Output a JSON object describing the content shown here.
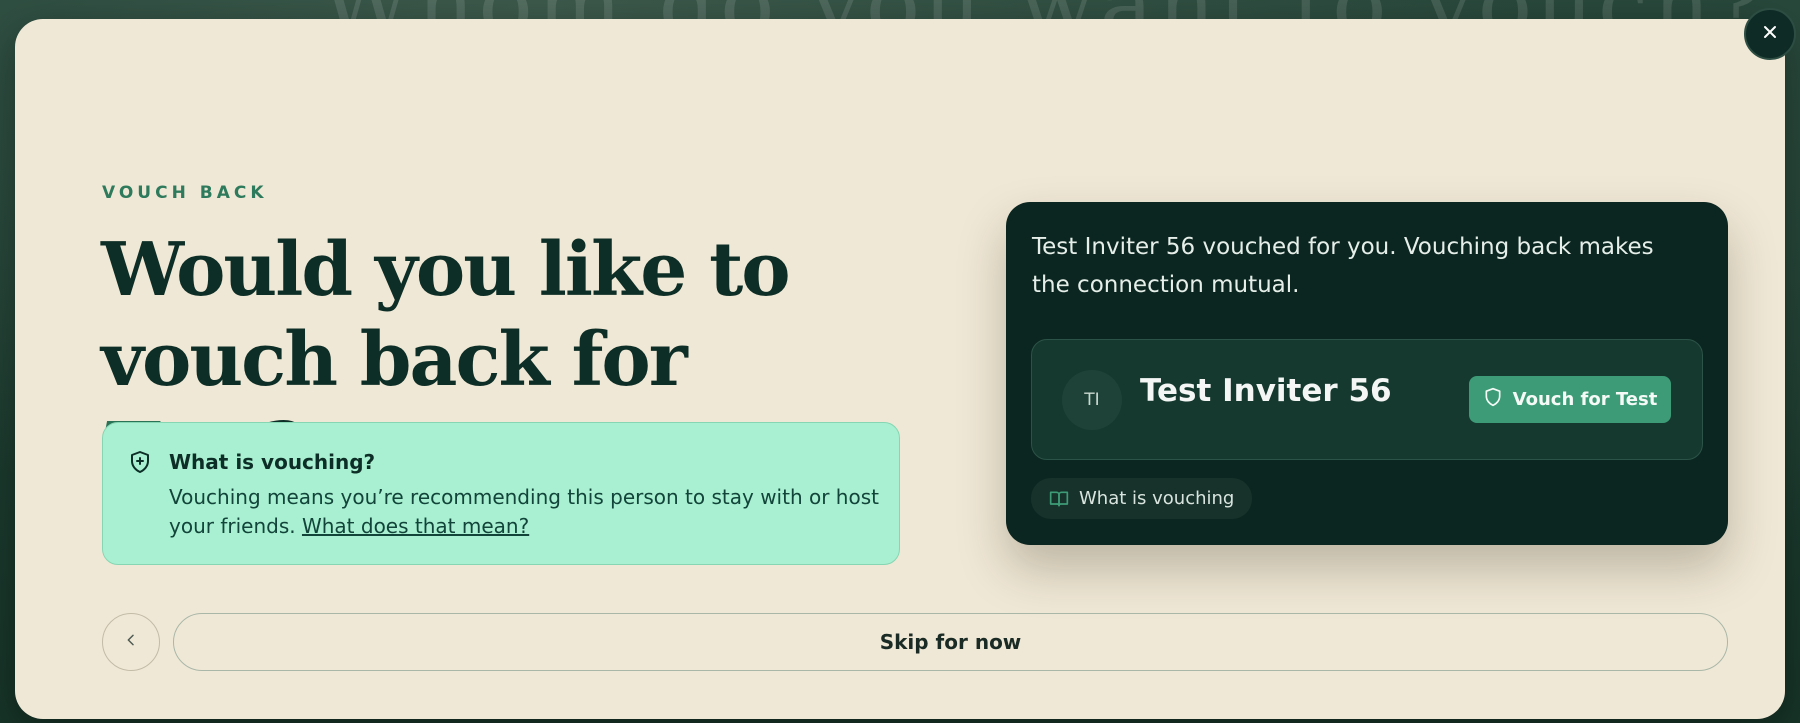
{
  "backdrop": {
    "text": "Whom do you want to vouch?"
  },
  "modal": {
    "close_icon": "close-icon",
    "eyebrow": "VOUCH BACK",
    "headline": {
      "line1": "Would you like to",
      "line2_prefix": "vouch back for ",
      "name": "Test",
      "suffix": "?"
    },
    "info": {
      "icon": "shield-plus-icon",
      "title": "What is vouching?",
      "body": "Vouching means you’re recommending this person to stay with or host your friends.",
      "link": "What does that mean?"
    },
    "card": {
      "description": "Test Inviter 56 vouched for you. Vouching back makes the connection mutual.",
      "person": {
        "initials": "TI",
        "name": "Test Inviter 56",
        "vouch_button": "Vouch for Test",
        "vouch_icon": "shield-icon"
      },
      "what_pill": {
        "label": "What is vouching",
        "icon": "book-open-icon"
      }
    },
    "footer": {
      "back_icon": "chevron-left-icon",
      "skip_label": "Skip for now"
    }
  },
  "colors": {
    "modal_bg": "#f0e8d6",
    "card_bg": "#0b2620",
    "accent": "#2a7357",
    "button": "#3d9c77",
    "info_bg": "#a8f0d1"
  }
}
